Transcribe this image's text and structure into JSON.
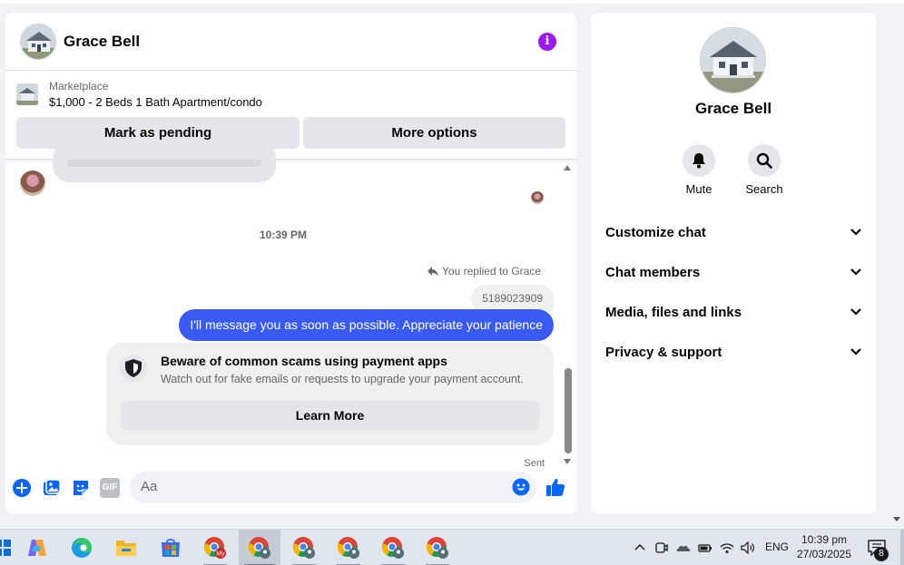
{
  "chat": {
    "contact_name": "Grace Bell",
    "listing": {
      "source": "Marketplace",
      "title": "$1,000 - 2 Beds 1 Bath Apartment/condo",
      "mark_pending_label": "Mark as pending",
      "more_options_label": "More options"
    },
    "messages": {
      "timestamp": "10:39 PM",
      "reply_note": "You replied to Grace",
      "quoted_text": "5189023909",
      "sent_text": "I'll message you as soon as possible. Appreciate your patience",
      "scam_title": "Beware of common scams using payment apps",
      "scam_subtitle": "Watch out for fake emails or requests to upgrade your payment account.",
      "learn_more_label": "Learn More",
      "status": "Sent"
    },
    "composer": {
      "placeholder": "Aa",
      "gif_label": "GIF"
    },
    "colors": {
      "accent": "#3a5af5",
      "info": "#a019f0",
      "like": "#0866ff"
    }
  },
  "info_panel": {
    "name": "Grace Bell",
    "actions": [
      {
        "label": "Mute",
        "icon": "bell-icon"
      },
      {
        "label": "Search",
        "icon": "search-icon"
      }
    ],
    "sections": [
      {
        "label": "Customize chat"
      },
      {
        "label": "Chat members"
      },
      {
        "label": "Media, files and links"
      },
      {
        "label": "Privacy & support"
      }
    ]
  },
  "taskbar": {
    "language": "ENG",
    "time": "10:39 pm",
    "date": "27/03/2025",
    "notification_count": "8",
    "apps": [
      "copilot-icon",
      "edge-icon",
      "file-explorer-icon",
      "store-icon",
      "chrome-profile-icon",
      "chrome-profile-icon",
      "chrome-profile-icon",
      "chrome-profile-icon",
      "chrome-profile-icon",
      "chrome-profile-icon"
    ]
  }
}
